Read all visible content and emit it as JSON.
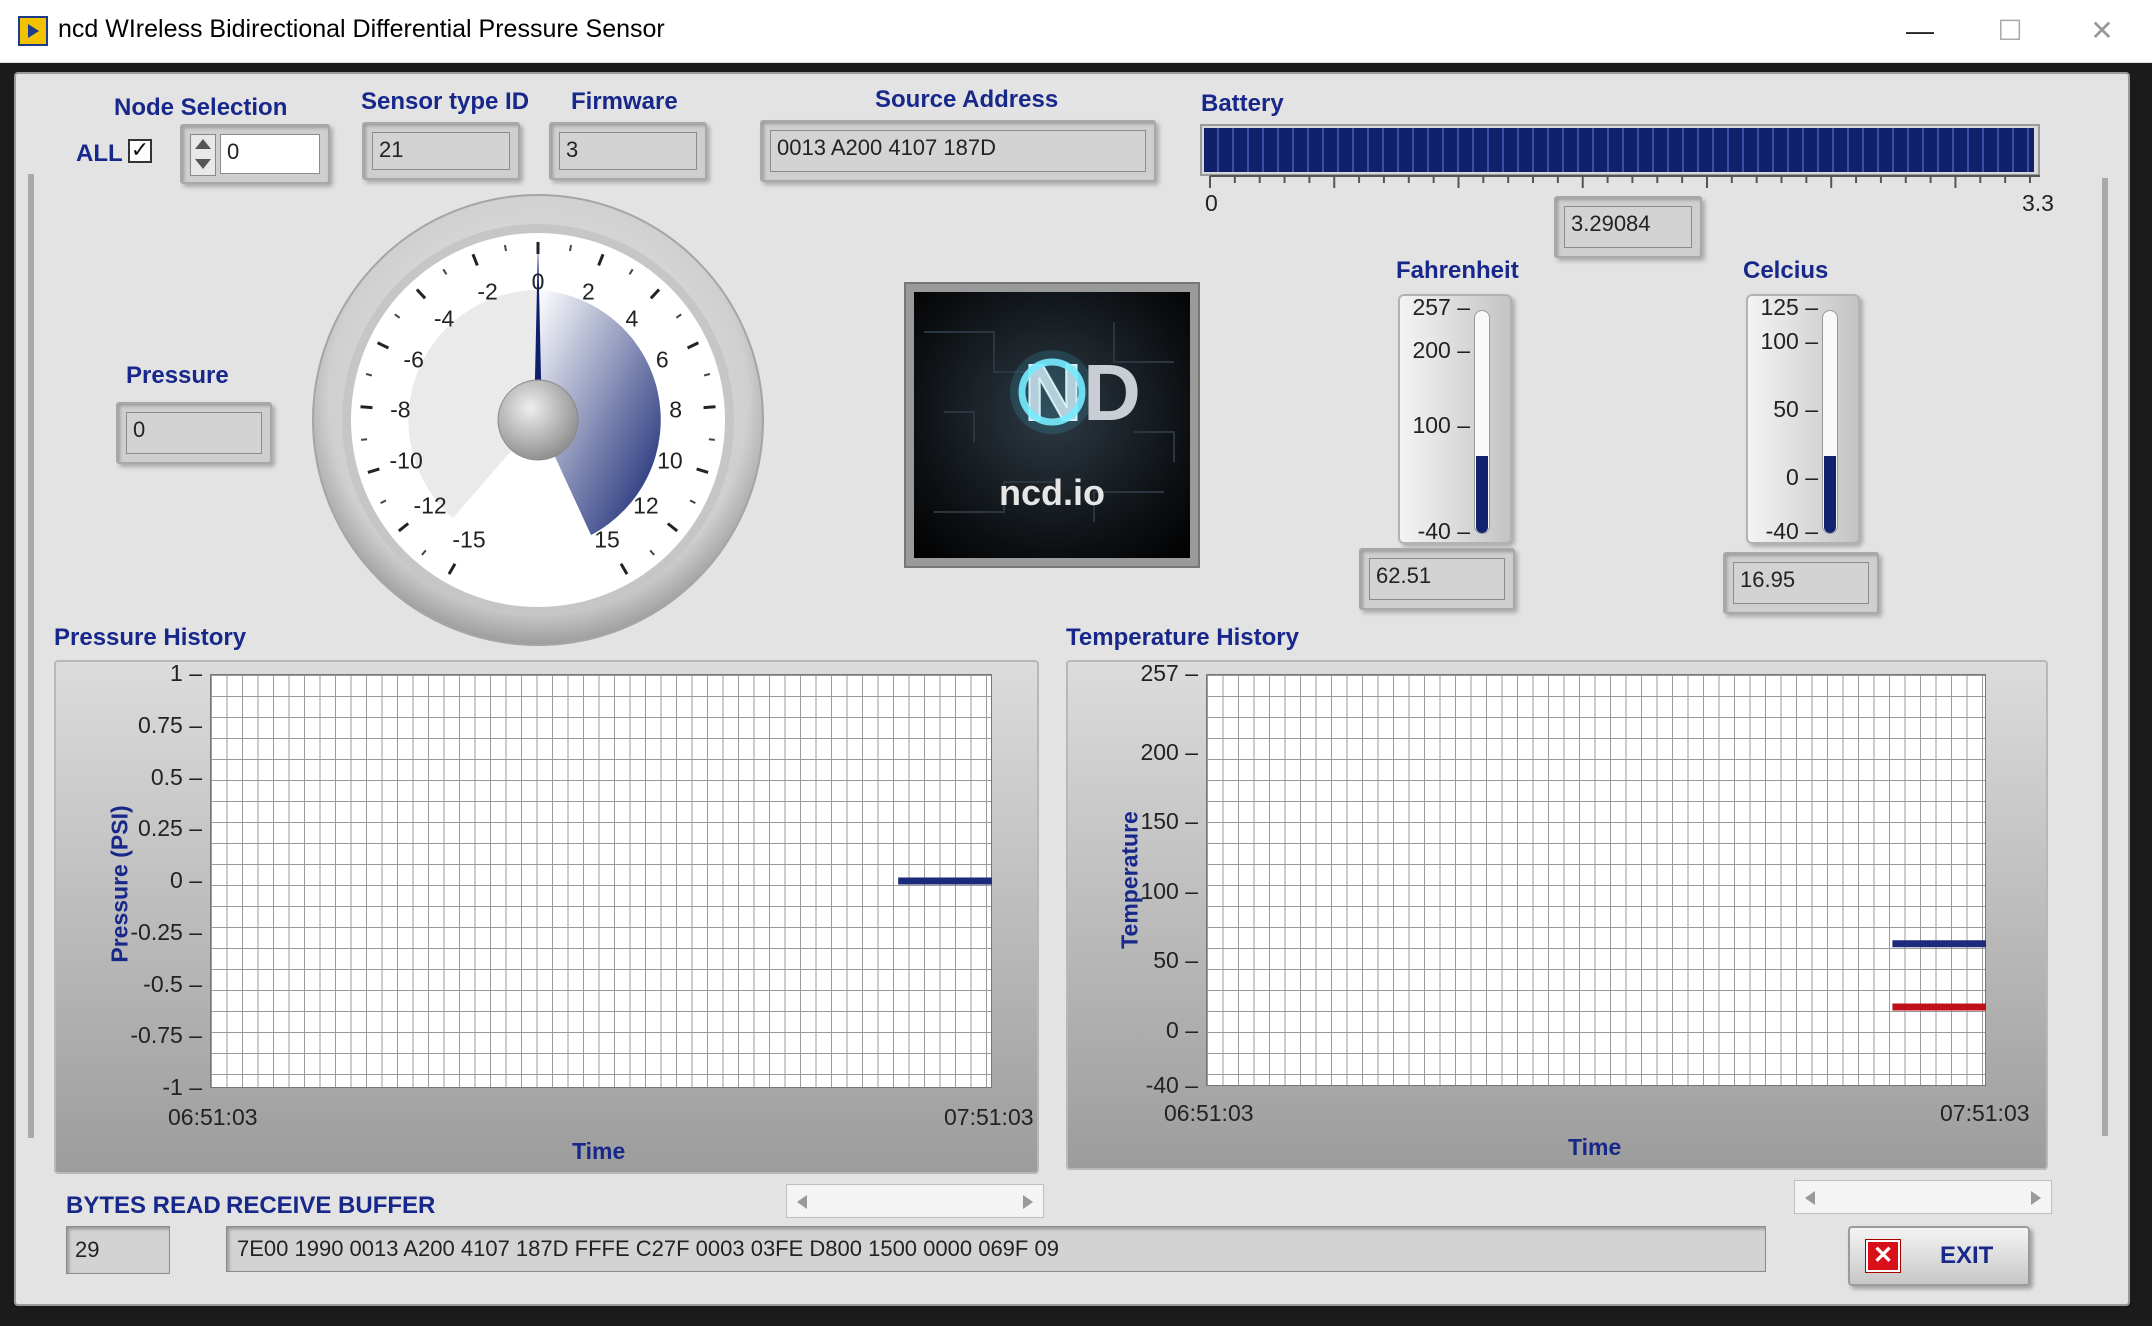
{
  "window": {
    "title": "ncd WIreless Bidirectional Differential Pressure Sensor",
    "minimize": "—",
    "maximize": "☐",
    "close": "✕"
  },
  "node_selection": {
    "label": "Node Selection",
    "all_label": "ALL",
    "all_checked": true,
    "value": "0"
  },
  "sensor_type": {
    "label": "Sensor type ID",
    "value": "21"
  },
  "firmware": {
    "label": "Firmware",
    "value": "3"
  },
  "source_address": {
    "label": "Source Address",
    "value": "0013 A200 4107 187D"
  },
  "battery": {
    "label": "Battery",
    "min": "0",
    "max": "3.3",
    "value": "3.29084",
    "level": 3.29084
  },
  "pressure": {
    "label": "Pressure",
    "value": "0",
    "gauge_ticks": [
      "-15",
      "-12",
      "-10",
      "-8",
      "-6",
      "-4",
      "-2",
      "0",
      "2",
      "4",
      "6",
      "8",
      "10",
      "12",
      "15"
    ],
    "needle_value": 0
  },
  "logo": {
    "text": "ncd.io",
    "brand": "NCD"
  },
  "fahrenheit": {
    "label": "Fahrenheit",
    "ticks": [
      "257",
      "200",
      "100",
      "-40"
    ],
    "value": "62.51"
  },
  "celcius": {
    "label": "Celcius",
    "ticks": [
      "125",
      "100",
      "50",
      "0",
      "-40"
    ],
    "value": "16.95"
  },
  "pressure_history": {
    "title": "Pressure History",
    "chart_data": {
      "type": "line",
      "xlabel": "Time",
      "ylabel": "Pressure (PSI)",
      "x_ticks": [
        "06:51:03",
        "07:51:03"
      ],
      "y_ticks": [
        "1",
        "0.75",
        "0.5",
        "0.25",
        "0",
        "-0.25",
        "-0.5",
        "-0.75",
        "-1"
      ],
      "ylim": [
        -1,
        1
      ],
      "series": [
        {
          "color": "#1b2a7a",
          "points": [
            [
              0.88,
              0
            ],
            [
              1.0,
              0
            ]
          ]
        }
      ]
    }
  },
  "temperature_history": {
    "title": "Temperature History",
    "chart_data": {
      "type": "line",
      "xlabel": "Time",
      "ylabel": "Temperature",
      "x_ticks": [
        "06:51:03",
        "07:51:03"
      ],
      "y_ticks": [
        "257",
        "200",
        "150",
        "100",
        "50",
        "0",
        "-40"
      ],
      "ylim": [
        -40,
        257
      ],
      "series": [
        {
          "color": "#1b2a7a",
          "points": [
            [
              0.88,
              62.51
            ],
            [
              1.0,
              62.51
            ]
          ]
        },
        {
          "color": "#c0111a",
          "points": [
            [
              0.88,
              16.95
            ],
            [
              1.0,
              16.95
            ]
          ]
        }
      ]
    }
  },
  "bytes_read": {
    "label": "BYTES READ",
    "value": "29"
  },
  "receive_buffer": {
    "label": "RECEIVE BUFFER",
    "value": "7E00 1990 0013 A200 4107 187D FFFE C27F 0003 03FE D800 1500 0000 069F 09"
  },
  "exit": {
    "label": "EXIT"
  }
}
